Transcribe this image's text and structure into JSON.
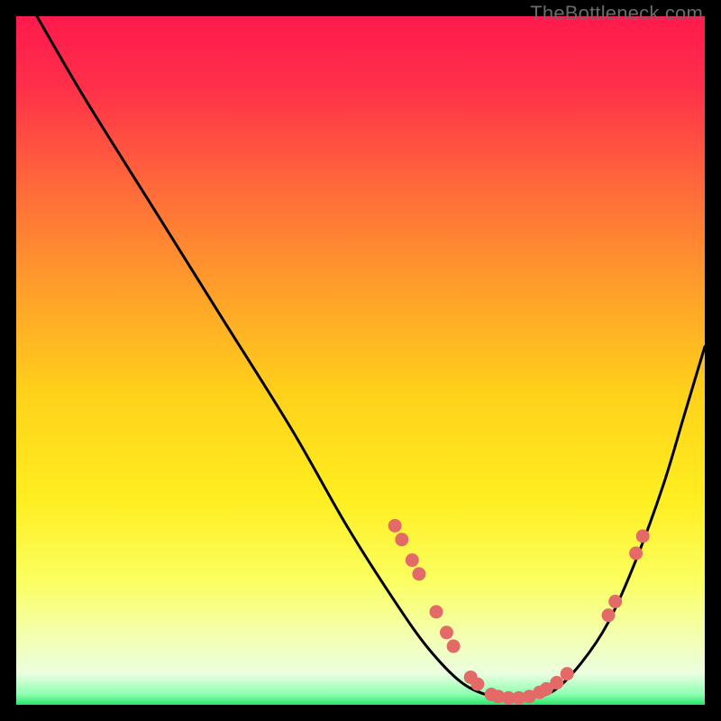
{
  "watermark": "TheBottleneck.com",
  "gradient": {
    "stops": [
      {
        "offset": 0.0,
        "color": "#ff1a4d"
      },
      {
        "offset": 0.1,
        "color": "#ff2f4a"
      },
      {
        "offset": 0.25,
        "color": "#ff6a3a"
      },
      {
        "offset": 0.4,
        "color": "#ffa02a"
      },
      {
        "offset": 0.55,
        "color": "#ffd21a"
      },
      {
        "offset": 0.7,
        "color": "#ffee20"
      },
      {
        "offset": 0.82,
        "color": "#fbff60"
      },
      {
        "offset": 0.9,
        "color": "#f4ffb0"
      },
      {
        "offset": 0.955,
        "color": "#eaffe0"
      },
      {
        "offset": 0.985,
        "color": "#8cffb0"
      },
      {
        "offset": 1.0,
        "color": "#28e56a"
      }
    ]
  },
  "chart_data": {
    "type": "line",
    "title": "",
    "xlabel": "",
    "ylabel": "",
    "xlim": [
      0,
      100
    ],
    "ylim": [
      0,
      100
    ],
    "series": [
      {
        "name": "bottleneck-curve",
        "x": [
          3,
          10,
          20,
          30,
          40,
          48,
          55,
          60,
          65,
          70,
          74,
          78,
          82,
          86,
          90,
          94,
          97,
          100
        ],
        "y": [
          100,
          88,
          72,
          56,
          40,
          26,
          15,
          8,
          3,
          1,
          1,
          2,
          6,
          12,
          21,
          32,
          42,
          52
        ]
      }
    ],
    "markers": {
      "name": "highlight-points",
      "color": "#e36a66",
      "points": [
        {
          "x": 55.0,
          "y": 26.0
        },
        {
          "x": 56.0,
          "y": 24.0
        },
        {
          "x": 57.5,
          "y": 21.0
        },
        {
          "x": 58.5,
          "y": 19.0
        },
        {
          "x": 61.0,
          "y": 13.5
        },
        {
          "x": 62.5,
          "y": 10.5
        },
        {
          "x": 63.5,
          "y": 8.5
        },
        {
          "x": 66.0,
          "y": 4.0
        },
        {
          "x": 67.0,
          "y": 3.0
        },
        {
          "x": 69.0,
          "y": 1.5
        },
        {
          "x": 70.0,
          "y": 1.2
        },
        {
          "x": 71.5,
          "y": 1.0
        },
        {
          "x": 73.0,
          "y": 1.0
        },
        {
          "x": 74.5,
          "y": 1.2
        },
        {
          "x": 76.0,
          "y": 1.8
        },
        {
          "x": 77.0,
          "y": 2.3
        },
        {
          "x": 78.5,
          "y": 3.2
        },
        {
          "x": 80.0,
          "y": 4.5
        },
        {
          "x": 86.0,
          "y": 13.0
        },
        {
          "x": 87.0,
          "y": 15.0
        },
        {
          "x": 90.0,
          "y": 22.0
        },
        {
          "x": 91.0,
          "y": 24.5
        }
      ]
    }
  }
}
